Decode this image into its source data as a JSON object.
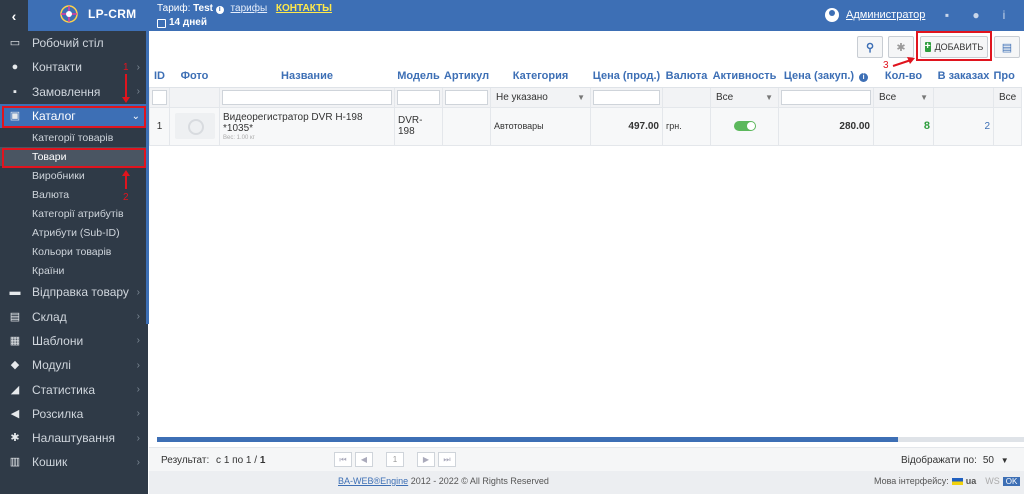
{
  "topbar": {
    "back_icon": "chevron-left-icon",
    "logo_text": "LP-CRM",
    "tariff_label": "Тариф:",
    "tariff_name": "Test",
    "tariffs_link": "тарифы",
    "contacts_link": "КОНТАКТЫ",
    "days": "14 дней",
    "user_name": "Администратор"
  },
  "sidebar": {
    "items": [
      {
        "label": "Робочий стіл",
        "icon": "desktop-icon"
      },
      {
        "label": "Контакти",
        "icon": "users-icon"
      },
      {
        "label": "Замовлення",
        "icon": "cart-icon"
      },
      {
        "label": "Каталог",
        "icon": "inbox-icon"
      },
      {
        "label": "Відправка товару",
        "icon": "truck-icon"
      },
      {
        "label": "Склад",
        "icon": "archive-icon"
      },
      {
        "label": "Шаблони",
        "icon": "template-icon"
      },
      {
        "label": "Модулі",
        "icon": "puzzle-icon"
      },
      {
        "label": "Статистика",
        "icon": "chart-icon"
      },
      {
        "label": "Розсилка",
        "icon": "megaphone-icon"
      },
      {
        "label": "Налаштування",
        "icon": "gear-icon"
      },
      {
        "label": "Кошик",
        "icon": "trash-icon"
      }
    ],
    "catalog_sub": [
      "Категорії товарів",
      "Товари",
      "Виробники",
      "Валюта",
      "Категорії атрибутів",
      "Атрибути (Sub-ID)",
      "Кольори товарів",
      "Країни"
    ],
    "annotations": [
      "1",
      "2",
      "3"
    ]
  },
  "toolbar": {
    "add_label": "ДОБАВИТЬ"
  },
  "table": {
    "headers": [
      "ID",
      "Фото",
      "Название",
      "Модель",
      "Артикул",
      "Категория",
      "Цена (прод.)",
      "Валюта",
      "Активность",
      "Цена (закуп.)",
      "Кол-во",
      "В заказах",
      "Про"
    ],
    "filters": {
      "category": "Не указано",
      "activity": "Все",
      "qty": "Все",
      "last": "Все"
    },
    "rows": [
      {
        "id": "1",
        "name": "Видеорегистратор DVR H-198 *1035*",
        "weight": "Вес: 1.00 кг",
        "model": "DVR-198",
        "article": "",
        "category": "Автотовары",
        "price": "497.00",
        "currency": "грн.",
        "active": true,
        "purchase_price": "280.00",
        "qty": "8",
        "in_orders": "2"
      }
    ]
  },
  "bottom": {
    "result_label": "Результат:",
    "result_range": "с 1 по 1 /",
    "result_total": "1",
    "page": "1",
    "per_page_label": "Відображати по:",
    "per_page_value": "50"
  },
  "footer": {
    "copyright_link": "BA-WEB®Engine",
    "copyright_text": "2012 - 2022 © All Rights Reserved",
    "lang_label": "Мова інтерфейсу:",
    "lang_code": "ua",
    "ws_label": "WS",
    "ok_label": "OK"
  },
  "colors": {
    "primary": "#3d6fb5",
    "sidebar_bg": "#2f3a47",
    "annotation": "#e0141e",
    "success": "#2e9e3e"
  }
}
